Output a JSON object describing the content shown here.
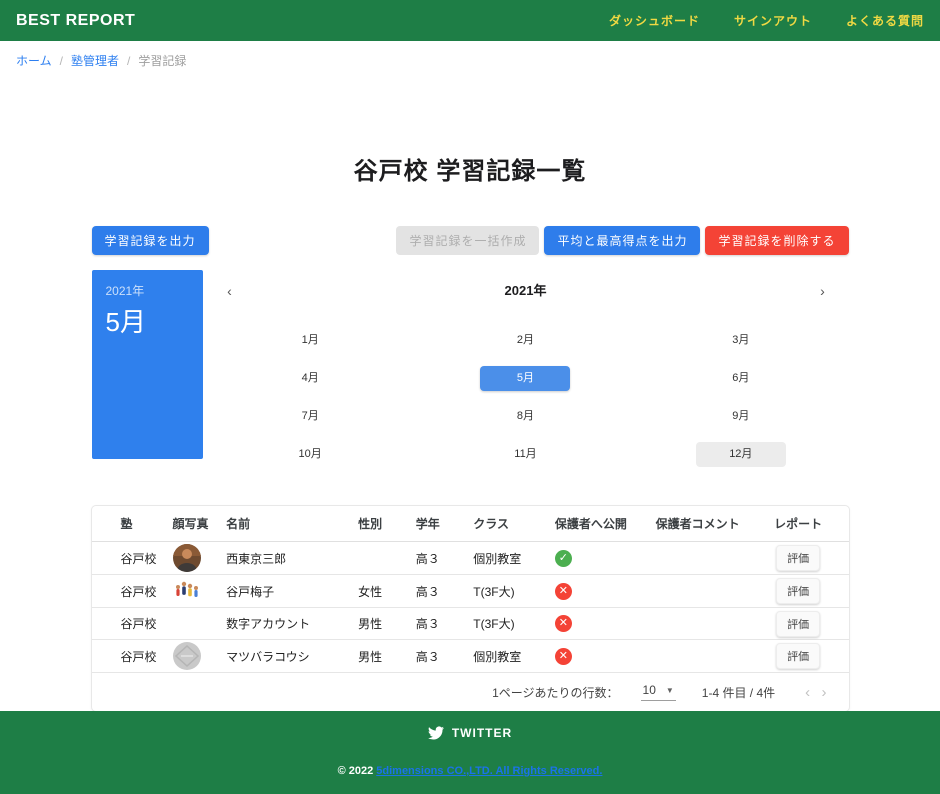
{
  "header": {
    "brand": "BEST REPORT",
    "nav": [
      {
        "id": "dashboard",
        "label": "ダッシュボード"
      },
      {
        "id": "signout",
        "label": "サインアウト"
      },
      {
        "id": "faq",
        "label": "よくある質問"
      }
    ]
  },
  "breadcrumb": {
    "separator": "/",
    "items": [
      {
        "id": "home",
        "label": "ホーム",
        "link": true
      },
      {
        "id": "juku-admin",
        "label": "塾管理者",
        "link": true
      },
      {
        "id": "study-records",
        "label": "学習記録",
        "link": false
      }
    ]
  },
  "page": {
    "title": "谷戸校 学習記録一覧"
  },
  "actions": {
    "export_records": "学習記録を出力",
    "bulk_create": "学習記録を一括作成",
    "export_averages": "平均と最高得点を出力",
    "delete_records": "学習記録を削除する"
  },
  "datepicker": {
    "panel_year": "2021年",
    "panel_month": "5月",
    "header_year": "2021年",
    "prev_icon": "‹",
    "next_icon": "›",
    "months": [
      "1月",
      "2月",
      "3月",
      "4月",
      "5月",
      "6月",
      "7月",
      "8月",
      "9月",
      "10月",
      "11月",
      "12月"
    ],
    "selected_month": "5月",
    "today_month": "12月"
  },
  "table": {
    "columns": [
      "塾",
      "顔写真",
      "名前",
      "性別",
      "学年",
      "クラス",
      "保護者へ公開",
      "保護者コメント",
      "レポート"
    ],
    "report_button_label": "評価",
    "rows": [
      {
        "school": "谷戸校",
        "avatar": "person",
        "name": "西東京三郎",
        "gender": "",
        "grade": "高３",
        "class": "個別教室",
        "visible": true,
        "comment": ""
      },
      {
        "school": "谷戸校",
        "avatar": "group",
        "name": "谷戸梅子",
        "gender": "女性",
        "grade": "高３",
        "class": "T(3F大)",
        "visible": false,
        "comment": ""
      },
      {
        "school": "谷戸校",
        "avatar": "none",
        "name": "数字アカウント",
        "gender": "男性",
        "grade": "高３",
        "class": "T(3F大)",
        "visible": false,
        "comment": ""
      },
      {
        "school": "谷戸校",
        "avatar": "placeholder",
        "name": "マツバラコウシ",
        "gender": "男性",
        "grade": "高３",
        "class": "個別教室",
        "visible": false,
        "comment": ""
      }
    ]
  },
  "icons": {
    "visible_true": "✓",
    "visible_false": "✕"
  },
  "pagination": {
    "rows_per_page_label": "1ページあたりの行数：",
    "rows_per_page_value": "10",
    "range_label": "1-4 件目 / 4件",
    "prev_icon": "‹",
    "next_icon": "›"
  },
  "footer": {
    "twitter_label": "TWITTER",
    "copyright_prefix": "© 2022",
    "copyright_link": "5dimensions CO.,LTD. All Rights Reserved."
  },
  "colors": {
    "brand_green": "#1e7e46",
    "nav_yellow": "#f0d943",
    "accent_blue": "#2e7deb",
    "panel_blue": "#2f80ed",
    "selected_month_blue": "#4b8fe9",
    "danger_red": "#f44336",
    "link_blue": "#2d7ff0",
    "footer_link_blue": "#1a73e8",
    "success_green": "#4caf50"
  }
}
